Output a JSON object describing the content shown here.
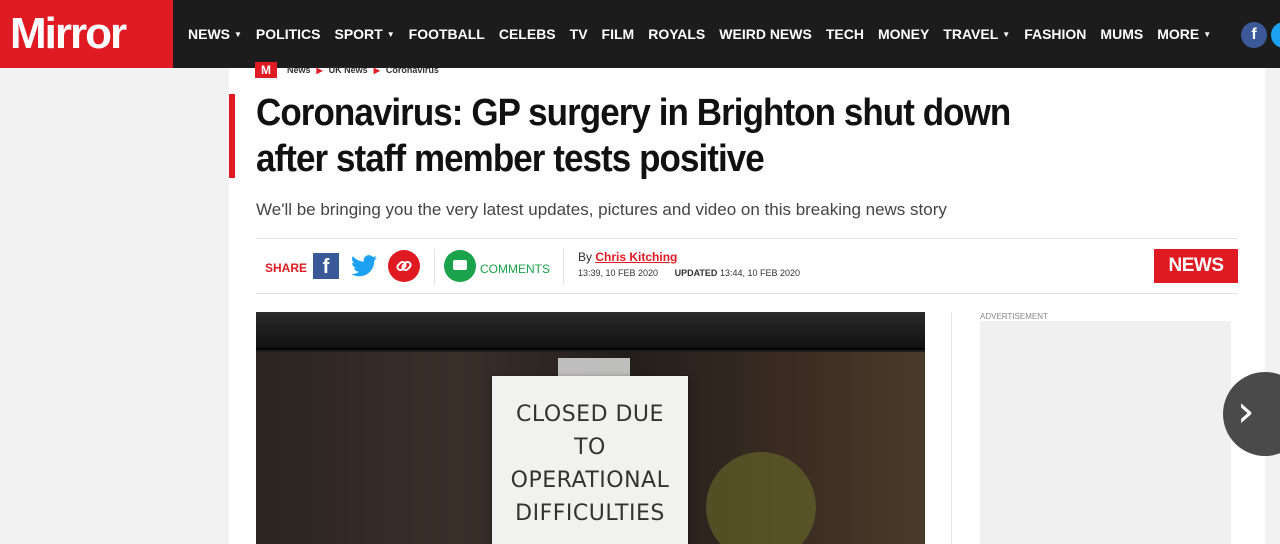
{
  "brand": {
    "logo_text": "Mirror",
    "accent_color": "#e01a22"
  },
  "nav": {
    "items": [
      {
        "label": "NEWS",
        "dropdown": true
      },
      {
        "label": "POLITICS",
        "dropdown": false
      },
      {
        "label": "SPORT",
        "dropdown": true
      },
      {
        "label": "FOOTBALL",
        "dropdown": false
      },
      {
        "label": "CELEBS",
        "dropdown": false
      },
      {
        "label": "TV",
        "dropdown": false
      },
      {
        "label": "FILM",
        "dropdown": false
      },
      {
        "label": "ROYALS",
        "dropdown": false
      },
      {
        "label": "WEIRD NEWS",
        "dropdown": false
      },
      {
        "label": "TECH",
        "dropdown": false
      },
      {
        "label": "MONEY",
        "dropdown": false
      },
      {
        "label": "TRAVEL",
        "dropdown": true
      },
      {
        "label": "FASHION",
        "dropdown": false
      },
      {
        "label": "MUMS",
        "dropdown": false
      },
      {
        "label": "MORE",
        "dropdown": true
      }
    ],
    "social": [
      {
        "icon": "facebook-icon",
        "glyph": "f"
      },
      {
        "icon": "twitter-icon",
        "glyph": "t"
      }
    ]
  },
  "breadcrumb": {
    "icon_glyph": "M",
    "items": [
      "News",
      "UK News",
      "Coronavirus"
    ]
  },
  "article": {
    "headline": "Coronavirus: GP surgery in Brighton shut down after staff member tests positive",
    "standfirst": "We'll be bringing you the very latest updates, pictures and video on this breaking news story",
    "share_label": "SHARE",
    "comments_label": "COMMENTS",
    "byline_prefix": "By",
    "author": "Chris Kitching",
    "published": "13:39, 10 FEB 2020",
    "updated_label": "UPDATED",
    "updated": "13:44, 10 FEB 2020",
    "section_badge": "NEWS",
    "facebook_glyph": "f"
  },
  "photo": {
    "sign_lines": [
      "CLOSED DUE",
      "TO",
      "OPERATIONAL",
      "DIFFICULTIES"
    ]
  },
  "sidebar": {
    "ad_label": "ADVERTISEMENT"
  },
  "carousel": {
    "next_glyph": "›"
  }
}
